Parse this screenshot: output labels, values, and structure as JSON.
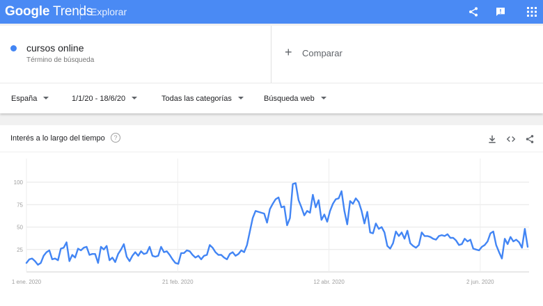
{
  "header": {
    "logo_google": "Google",
    "logo_trends": "Trends",
    "section": "Explorar",
    "icons": [
      "share-icon",
      "feedback-icon",
      "apps-grid-icon"
    ]
  },
  "term": {
    "name": "cursos online",
    "subtitle": "Término de búsqueda",
    "color": "#4285f4"
  },
  "compare": {
    "plus": "+",
    "label": "Comparar"
  },
  "filters": {
    "region": "España",
    "dates": "1/1/20 - 18/6/20",
    "category": "Todas las categorías",
    "search_type": "Búsqueda web"
  },
  "interest_card": {
    "title": "Interés a lo largo del tiempo",
    "help": "?",
    "icons": [
      "download-icon",
      "embed-icon",
      "share-icon"
    ]
  },
  "chart_data": {
    "type": "line",
    "title": "",
    "xlabel": "",
    "ylabel": "",
    "ylim": [
      0,
      100
    ],
    "yticks": [
      25,
      50,
      75,
      100
    ],
    "xticks": [
      {
        "date": "2020-01-01",
        "label": "1 ene. 2020"
      },
      {
        "date": "2020-02-21",
        "label": "21 feb. 2020"
      },
      {
        "date": "2020-04-12",
        "label": "12 abr. 2020"
      },
      {
        "date": "2020-06-02",
        "label": "2 jun. 2020"
      }
    ],
    "x_start": "2020-01-01",
    "x_end": "2020-06-18",
    "grid": true,
    "color": "#4285f4",
    "series": [
      {
        "values": [
          10,
          14,
          15,
          12,
          8,
          10,
          18,
          22,
          24,
          14,
          15,
          13,
          26,
          27,
          33,
          12,
          19,
          16,
          26,
          24,
          27,
          28,
          19,
          20,
          20,
          10,
          28,
          25,
          29,
          13,
          16,
          11,
          20,
          25,
          31,
          17,
          12,
          18,
          22,
          18,
          23,
          20,
          21,
          28,
          18,
          17,
          18,
          28,
          22,
          23,
          19,
          14,
          10,
          9,
          21,
          21,
          24,
          23,
          19,
          16,
          18,
          14,
          18,
          19,
          30,
          27,
          22,
          19,
          19,
          16,
          14,
          20,
          22,
          18,
          20,
          24,
          22,
          30,
          45,
          60,
          68,
          67,
          66,
          65,
          55,
          70,
          76,
          81,
          83,
          72,
          73,
          52,
          60,
          98,
          99,
          80,
          72,
          63,
          68,
          66,
          86,
          72,
          80,
          58,
          64,
          56,
          68,
          76,
          81,
          82,
          90,
          68,
          53,
          79,
          76,
          82,
          78,
          68,
          54,
          67,
          44,
          43,
          54,
          48,
          50,
          44,
          29,
          26,
          32,
          45,
          40,
          44,
          37,
          46,
          32,
          29,
          27,
          30,
          44,
          40,
          40,
          39,
          37,
          36,
          40,
          41,
          40,
          42,
          38,
          38,
          35,
          30,
          31,
          37,
          34,
          36,
          26,
          25,
          24,
          28,
          30,
          34,
          43,
          45,
          30,
          22,
          15,
          37,
          31,
          39,
          34,
          36,
          33,
          27,
          48,
          28
        ]
      }
    ]
  }
}
